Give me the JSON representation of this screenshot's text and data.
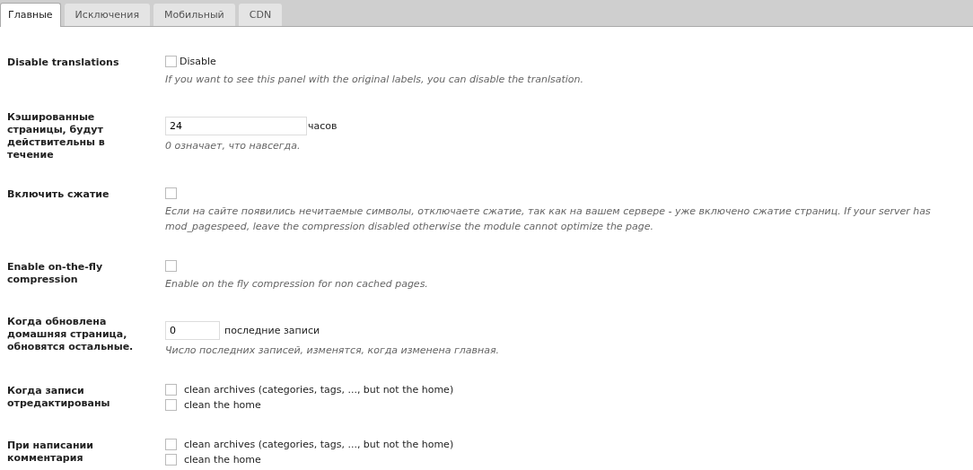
{
  "tabs": [
    {
      "label": "Главные",
      "selected": true
    },
    {
      "label": "Исключения",
      "selected": false
    },
    {
      "label": "Мобильный",
      "selected": false
    },
    {
      "label": "CDN",
      "selected": false
    }
  ],
  "settings": [
    {
      "kind": "checkbox",
      "label": "Disable translations",
      "checked": false,
      "option": "Disable",
      "description": "If you want to see this panel with the original labels, you can disable the tranlsation."
    },
    {
      "kind": "duration",
      "label": "Кэшированные страницы, будут действительны в течение",
      "value": "24",
      "unit": "часов",
      "description": "0 означает, что навсегда."
    },
    {
      "kind": "checkbox",
      "label": "Включить сжатие",
      "checked": false,
      "description": "Если на сайте появились нечитаемые символы, отключаете сжатие, так как на вашем сервере - уже включено сжатие страниц. If your server has mod_pagespeed, leave the compression disabled otherwise the module cannot optimize the page."
    },
    {
      "kind": "checkbox",
      "label": "Enable on-the-fly compression",
      "checked": false,
      "description": "Enable on the fly compression for non cached pages."
    },
    {
      "kind": "count",
      "label": "Когда обновлена домашняя страница, обновятся остальные.",
      "value": "0",
      "unit": "последние записи",
      "description": "Число последних записей, изменятся, когда изменена главная."
    },
    {
      "kind": "checklist",
      "label": "Когда записи отредактированы",
      "options": [
        {
          "label": "clean archives (categories, tags, ..., but not the home)",
          "checked": false
        },
        {
          "label": "clean the home",
          "checked": false
        }
      ]
    },
    {
      "kind": "checklist",
      "label": "При написании комментария",
      "options": [
        {
          "label": "clean archives (categories, tags, ..., but not the home)",
          "checked": false
        },
        {
          "label": "clean the home",
          "checked": false
        }
      ]
    }
  ]
}
